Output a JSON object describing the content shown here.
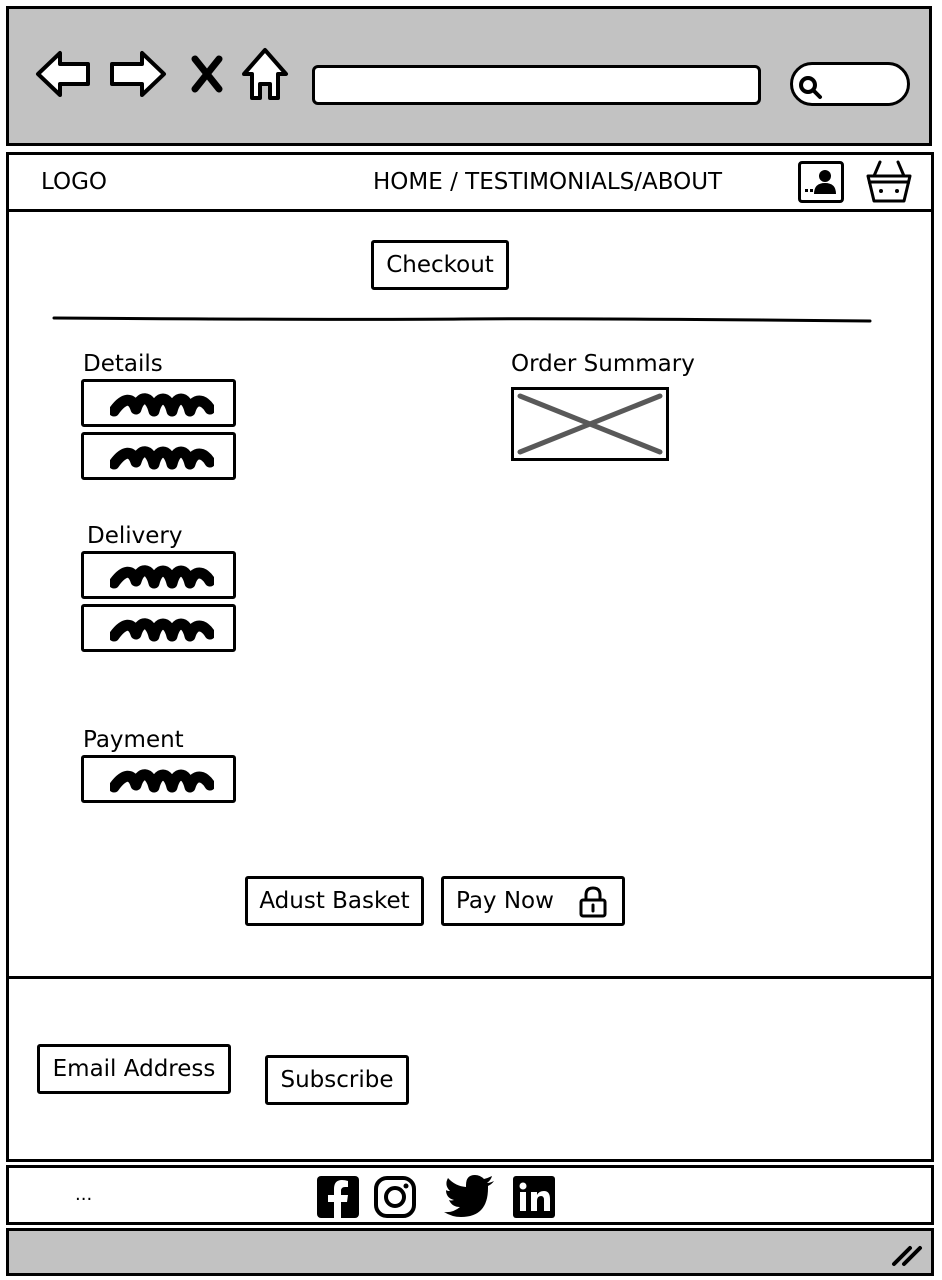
{
  "browser": {
    "icons": [
      "arrow-left-icon",
      "arrow-right-icon",
      "close-icon",
      "home-icon",
      "search-icon"
    ]
  },
  "nav": {
    "logo": "LOGO",
    "links": "HOME / TESTIMONIALS/ABOUT",
    "icons": [
      "account-icon",
      "basket-icon"
    ]
  },
  "main": {
    "checkout_label": "Checkout",
    "details_label": "Details",
    "delivery_label": "Delivery",
    "payment_label": "Payment",
    "order_summary_label": "Order Summary",
    "adjust_basket_label": "Adust Basket",
    "pay_now_label": "Pay Now"
  },
  "footer": {
    "email_label": "Email Address",
    "subscribe_label": "Subscribe",
    "ellipsis": "...",
    "social_icons": [
      "facebook-icon",
      "instagram-icon",
      "twitter-icon",
      "linkedin-icon"
    ]
  },
  "colors": {
    "chrome_bg": "#c2c2c2",
    "placeholder_line": "#595959",
    "ink": "#000000"
  }
}
